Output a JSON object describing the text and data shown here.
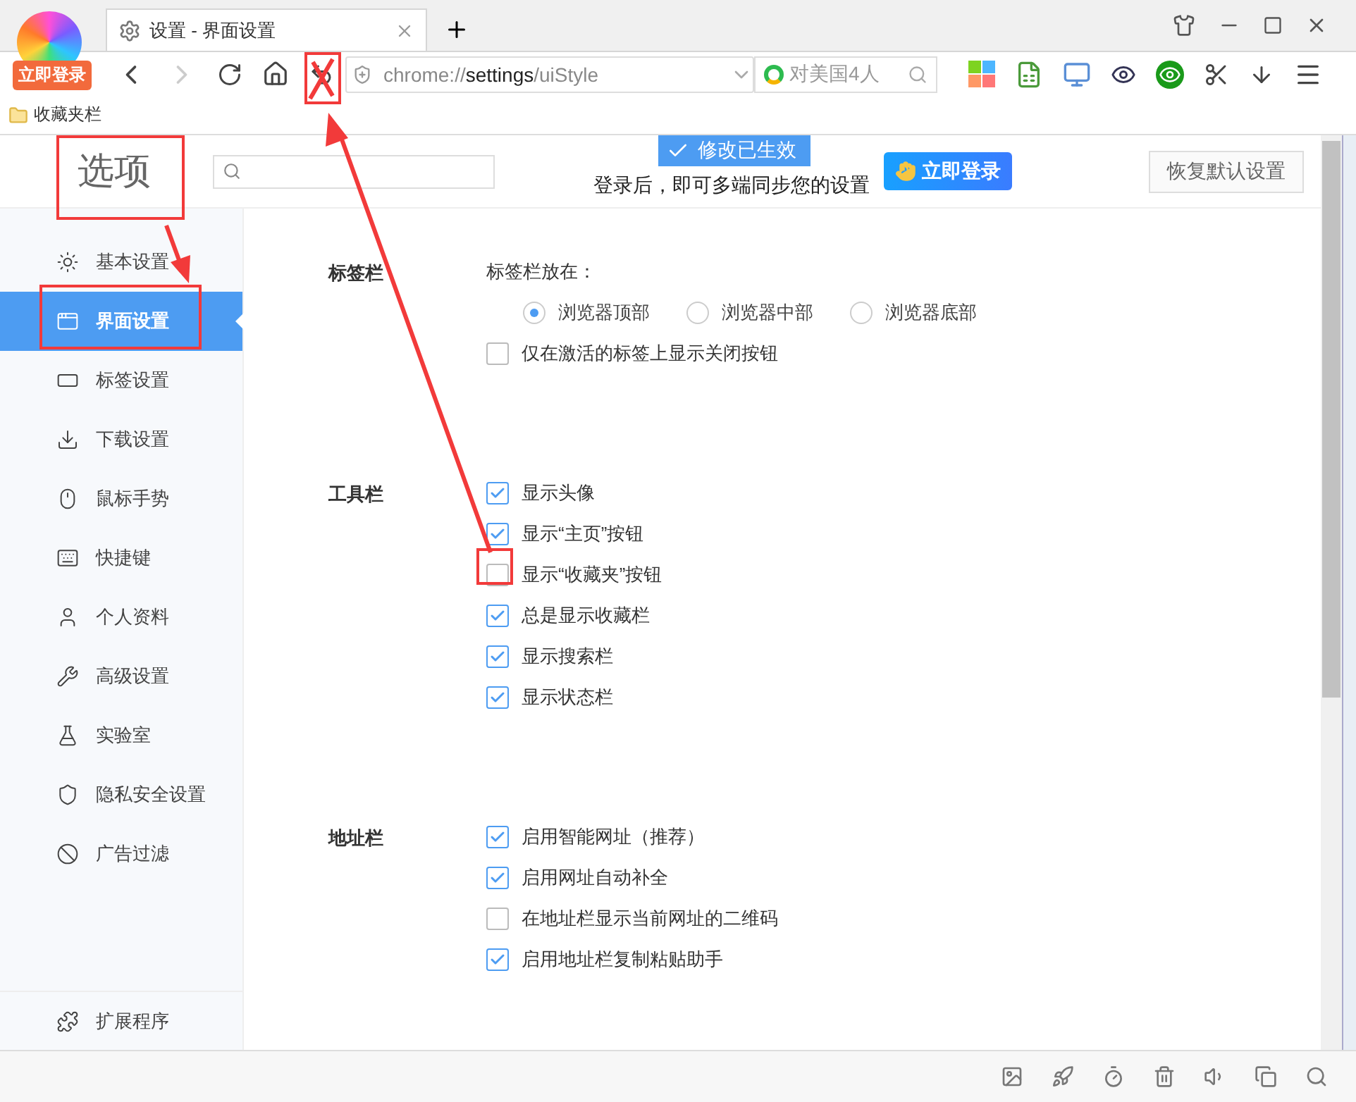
{
  "browser": {
    "tab_title": "设置 - 界面设置",
    "login_badge": "立即登录",
    "address": {
      "scheme": "chrome://",
      "host": "settings",
      "path": "/uiStyle"
    },
    "search_placeholder": "对美国4人",
    "bookmarks": [
      {
        "label": "收藏夹栏"
      }
    ]
  },
  "page": {
    "title": "选项",
    "toast": "修改已生效",
    "notice": "登录后，即可多端同步您的设置",
    "login_button": "立即登录",
    "restore_button": "恢复默认设置"
  },
  "sidebar": {
    "items": [
      {
        "label": "基本设置",
        "selected": false
      },
      {
        "label": "界面设置",
        "selected": true
      },
      {
        "label": "标签设置",
        "selected": false
      },
      {
        "label": "下载设置",
        "selected": false
      },
      {
        "label": "鼠标手势",
        "selected": false
      },
      {
        "label": "快捷键",
        "selected": false
      },
      {
        "label": "个人资料",
        "selected": false
      },
      {
        "label": "高级设置",
        "selected": false
      },
      {
        "label": "实验室",
        "selected": false
      },
      {
        "label": "隐私安全设置",
        "selected": false
      },
      {
        "label": "广告过滤",
        "selected": false
      }
    ],
    "footer": {
      "label": "扩展程序"
    }
  },
  "sections": [
    {
      "title": "标签栏",
      "caption": "标签栏放在：",
      "radios": [
        {
          "label": "浏览器顶部",
          "selected": true
        },
        {
          "label": "浏览器中部",
          "selected": false
        },
        {
          "label": "浏览器底部",
          "selected": false
        }
      ],
      "options": [
        {
          "label": "仅在激活的标签上显示关闭按钮",
          "checked": false
        }
      ]
    },
    {
      "title": "工具栏",
      "options": [
        {
          "label": "显示头像",
          "checked": true
        },
        {
          "label": "显示“主页”按钮",
          "checked": true
        },
        {
          "label": "显示“收藏夹”按钮",
          "checked": false
        },
        {
          "label": "总是显示收藏栏",
          "checked": true
        },
        {
          "label": "显示搜索栏",
          "checked": true
        },
        {
          "label": "显示状态栏",
          "checked": true
        }
      ]
    },
    {
      "title": "地址栏",
      "options": [
        {
          "label": "启用智能网址（推荐）",
          "checked": true
        },
        {
          "label": "启用网址自动补全",
          "checked": true
        },
        {
          "label": "在地址栏显示当前网址的二维码",
          "checked": false
        },
        {
          "label": "启用地址栏复制粘贴助手",
          "checked": true
        }
      ]
    }
  ]
}
